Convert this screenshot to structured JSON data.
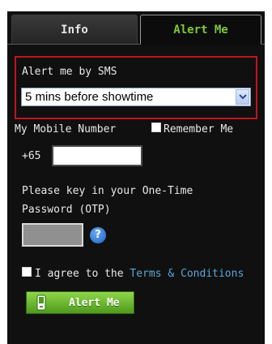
{
  "tabs": [
    {
      "label": "Info"
    },
    {
      "label": "Alert Me"
    }
  ],
  "sms": {
    "label": "Alert me by SMS",
    "selected": "5 mins before showtime"
  },
  "mobile": {
    "label": "My Mobile Number",
    "remember_label": "Remember Me",
    "country_code": "+65",
    "value": ""
  },
  "otp": {
    "line1": "Please key in your One-Time",
    "line2": "Password (OTP)",
    "help": "?"
  },
  "agree": {
    "prefix": "I agree to the",
    "link": "Terms & Conditions"
  },
  "button": {
    "label": "Alert Me",
    "icon": "mobile-phone-icon"
  },
  "colors": {
    "accent": "#7ec83a",
    "highlight_border": "#c0151b",
    "link": "#5aa6d8"
  }
}
